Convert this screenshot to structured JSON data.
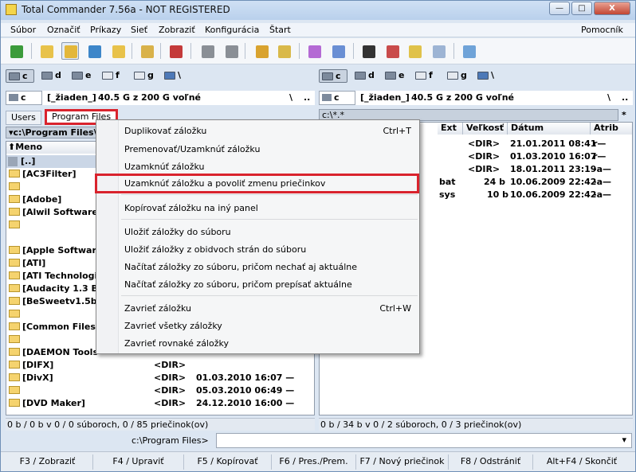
{
  "title": "Total Commander 7.56a - NOT REGISTERED",
  "title_buttons": {
    "min": "—",
    "max": "□",
    "close": "X"
  },
  "menu": [
    "Súbor",
    "Označiť",
    "Príkazy",
    "Sieť",
    "Zobraziť",
    "Konfigurácia",
    "Štart"
  ],
  "menu_right": "Pomocník",
  "drives": {
    "c": "c",
    "d": "d",
    "e": "e",
    "f": "f",
    "g": "g",
    "root": "\\"
  },
  "left_path": {
    "drive": "c",
    "label": "[_žiaden_]",
    "free": "40.5  G z 200  G voľné",
    "root": "\\",
    "up": ".."
  },
  "right_path": {
    "drive": "c",
    "label": "[_žiaden_]",
    "free": "40.5  G z 200  G voľné",
    "root": "\\",
    "up": "..",
    "filter": "c:\\*.*",
    "star": "*",
    "chev": "▾"
  },
  "left_tabs": {
    "users": "Users",
    "program_files": "Program Files"
  },
  "left_current": "▾c:\\Program Files\\",
  "left_header": {
    "name": "⬆Meno"
  },
  "left_rows": [
    {
      "name": "[..]"
    },
    {
      "name": "[AC3Filter]"
    },
    {
      "name": ""
    },
    {
      "name": "[Adobe]"
    },
    {
      "name": "[Alwil Software]"
    },
    {
      "name": ""
    },
    {
      "name": "[Apple Software"
    },
    {
      "name": "[ATI]"
    },
    {
      "name": "[ATI Technologie"
    },
    {
      "name": "[Audacity 1.3 Be"
    },
    {
      "name": "[BeSweetv1.5b3"
    },
    {
      "name": ""
    },
    {
      "name": "[Common Files]"
    },
    {
      "name": ""
    },
    {
      "name": "[DAEMON Tools"
    },
    {
      "name": "[DIFX]",
      "ext": "<DIR>",
      "date": ""
    },
    {
      "name": "[DivX]",
      "ext": "<DIR>",
      "date": "01.03.2010 16:07 —"
    },
    {
      "name": "",
      "ext": "<DIR>",
      "date": "05.03.2010 06:49 —"
    },
    {
      "name": "[DVD Maker]",
      "ext": "<DIR>",
      "date": "24.12.2010 16:00 —"
    }
  ],
  "right_headers": {
    "ext": "Ext",
    "size": "Veľkosť",
    "date": "Dátum",
    "attr": "Atrib"
  },
  "right_rows": [
    {
      "ext": "",
      "size": "<DIR>",
      "date": "21.01.2011 08:41",
      "attr": "r—"
    },
    {
      "ext": "",
      "size": "<DIR>",
      "date": "01.03.2010 16:07",
      "attr": "r—"
    },
    {
      "ext": "",
      "size": "<DIR>",
      "date": "18.01.2011 23:19",
      "attr": "-a—"
    },
    {
      "ext": "bat",
      "size": "24 b",
      "date": "10.06.2009 22:42",
      "attr": "-a—"
    },
    {
      "ext": "sys",
      "size": "10 b",
      "date": "10.06.2009 22:42",
      "attr": "-a—"
    }
  ],
  "status_left": "0 b / 0 b v 0 / 0 súboroch, 0 / 85 priečinok(ov)",
  "status_right": "0 b / 34 b v 0 / 2 súboroch, 0 / 3 priečinok(ov)",
  "cmd_prompt": "c:\\Program Files>",
  "fkeys": [
    "F3 / Zobraziť",
    "F4 / Upraviť",
    "F5 / Kopírovať",
    "F6 / Pres./Prem.",
    "F7 / Nový priečinok",
    "F8 / Odstrániť",
    "Alt+F4 / Skončiť"
  ],
  "context_menu": {
    "dup": "Duplikovať záložku",
    "dup_sc": "Ctrl+T",
    "rename": "Premenovať/Uzamknúť záložku",
    "lock": "Uzamknúť záložku",
    "lock_allow": "Uzamknúť záložku a povoliť zmenu priečinkov",
    "copy": "Kopírovať záložku na iný panel",
    "save": "Uložiť záložky do súboru",
    "save_both": "Uložiť záložky z obidvoch strán do súboru",
    "load_keep": "Načítať záložky zo súboru, pričom nechať aj aktuálne",
    "load_replace": "Načítať záložky zo súboru, pričom prepísať aktuálne",
    "close": "Zavrieť záložku",
    "close_sc": "Ctrl+W",
    "close_all": "Zavrieť všetky záložky",
    "close_same": "Zavrieť rovnaké záložky"
  },
  "colors": {
    "highlight": "#d9232d",
    "titlebar": "#c3d7ef"
  }
}
